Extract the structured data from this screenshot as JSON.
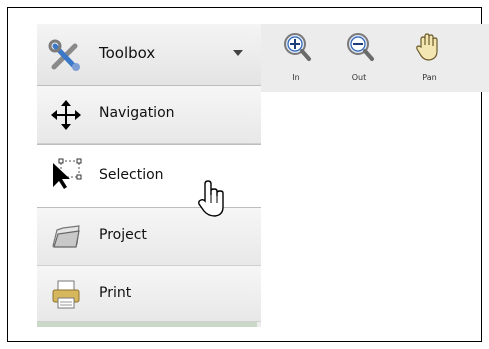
{
  "toolbox": {
    "title": "Toolbox",
    "items": [
      {
        "label": "Navigation",
        "icon": "move-arrows-icon"
      },
      {
        "label": "Selection",
        "icon": "selection-arrow-icon"
      },
      {
        "label": "Project",
        "icon": "folder-icon"
      },
      {
        "label": "Print",
        "icon": "printer-icon"
      }
    ]
  },
  "toolbar": {
    "zoom_in_label": "In",
    "zoom_out_label": "Out",
    "pan_label": "Pan"
  },
  "colors": {
    "menu_bg": "#eeeeee",
    "active_item_bg": "#ffffff",
    "accent_blue": "#2b62b5"
  }
}
